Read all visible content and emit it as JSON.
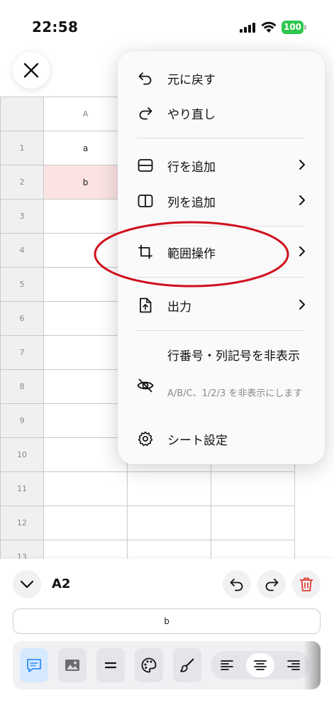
{
  "status_bar": {
    "time": "22:58",
    "battery": "100",
    "battery_color": "#2fc64d"
  },
  "close_button": {
    "icon": "close-icon"
  },
  "spreadsheet": {
    "column_headers": [
      "A",
      "",
      ""
    ],
    "row_numbers": [
      "1",
      "2",
      "3",
      "4",
      "5",
      "6",
      "7",
      "8",
      "9",
      "10",
      "11",
      "12",
      "13"
    ],
    "cells": {
      "A1": "a",
      "A2": "b"
    },
    "selected_cell_color": "#fbe3e3"
  },
  "menu": {
    "undo": "元に戻す",
    "redo": "やり直し",
    "add_row": "行を追加",
    "add_column": "列を追加",
    "range_ops": "範囲操作",
    "export": "出力",
    "hide_headers": "行番号・列記号を非表示",
    "hide_headers_desc": "A/B/C、1/2/3 を非表示にします",
    "sheet_settings": "シート設定"
  },
  "annotation": {
    "color": "#d0101d",
    "target": "範囲操作"
  },
  "bottom_panel": {
    "cell_ref": "A2",
    "formula_value": "b",
    "delete_color": "#e03a30",
    "active_tool_color": "#d6e9ff"
  }
}
